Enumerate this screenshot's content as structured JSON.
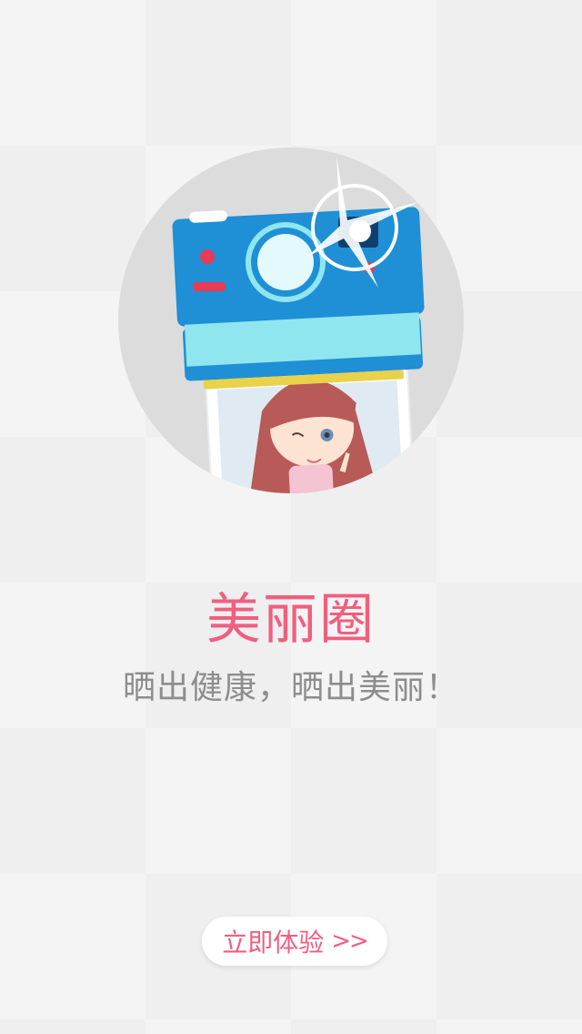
{
  "splash": {
    "title": "美丽圈",
    "subtitle": "晒出健康，晒出美丽！",
    "cta_label": "立即体验",
    "cta_icon": "double-chevron-right-icon",
    "cta_glyph": ">>"
  },
  "colors": {
    "accent": "#ef5f7f",
    "subtitle": "#8d8d8d",
    "background": "#f4f4f4",
    "camera_blue": "#1f8fd6"
  }
}
